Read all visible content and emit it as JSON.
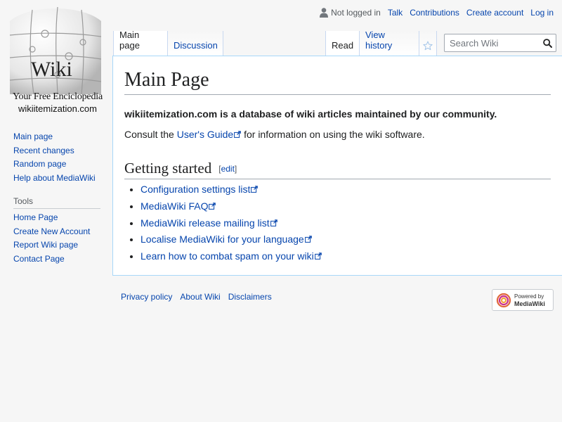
{
  "personal": {
    "status": "Not logged in",
    "links": [
      "Talk",
      "Contributions",
      "Create account",
      "Log in"
    ]
  },
  "logo": {
    "wordmark": "Wiki",
    "tagline": "Your Free Enciclopedia",
    "sitename": "wikiitemization.com"
  },
  "sidebar": {
    "navigation": [
      "Main page",
      "Recent changes",
      "Random page",
      "Help about MediaWiki"
    ],
    "tools_heading": "Tools",
    "tools": [
      "Home Page",
      "Create New Account",
      "Report Wiki page",
      "Contact Page"
    ]
  },
  "tabs": {
    "main_page": "Main page",
    "discussion": "Discussion",
    "read": "Read",
    "view_history": "View history",
    "watch_icon": "star-icon"
  },
  "search": {
    "placeholder": "Search Wiki",
    "icon": "search-icon"
  },
  "content": {
    "title": "Main Page",
    "intro": "wikiitemization.com is a database of wiki articles maintained by our community.",
    "consult_before": "Consult the ",
    "consult_link": "User's Guide",
    "consult_after": " for information on using the wiki software.",
    "section_heading": "Getting started",
    "edit_open": "[",
    "edit_label": "edit",
    "edit_close": "]",
    "links": [
      "Configuration settings list",
      "MediaWiki FAQ",
      "MediaWiki release mailing list",
      "Localise MediaWiki for your language",
      "Learn how to combat spam on your wiki"
    ]
  },
  "footer": {
    "links": [
      "Privacy policy",
      "About Wiki",
      "Disclaimers"
    ],
    "powered_small": "Powered by",
    "powered_big": "MediaWiki"
  },
  "colors": {
    "link": "#0645ad",
    "text": "#202122",
    "border": "#a7d7f9",
    "background": "#f6f6f6"
  }
}
